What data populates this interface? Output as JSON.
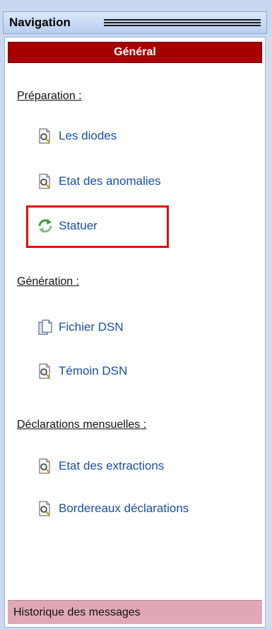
{
  "panel": {
    "title": "Navigation",
    "header": "Général"
  },
  "sections": [
    {
      "title": "Préparation :",
      "items": [
        {
          "label": "Les diodes",
          "icon": "document-search-icon"
        },
        {
          "label": "Etat des anomalies",
          "icon": "document-search-icon"
        },
        {
          "label": "Statuer",
          "icon": "refresh-arrows-icon"
        }
      ]
    },
    {
      "title": "Génération :",
      "items": [
        {
          "label": "Fichier DSN",
          "icon": "document-copy-icon"
        },
        {
          "label": "Témoin DSN",
          "icon": "document-search-icon"
        }
      ]
    },
    {
      "title": "Déclarations mensuelles :",
      "items": [
        {
          "label": "Etat des extractions",
          "icon": "document-search-icon"
        },
        {
          "label": "Bordereaux déclarations",
          "icon": "document-search-icon"
        }
      ]
    }
  ],
  "footer": {
    "label": "Historique des messages"
  },
  "colors": {
    "accent_red": "#a80000",
    "highlight_box": "#e10b0b",
    "link_blue": "#1a4fa3",
    "footer_pink": "#e0a8b4"
  }
}
